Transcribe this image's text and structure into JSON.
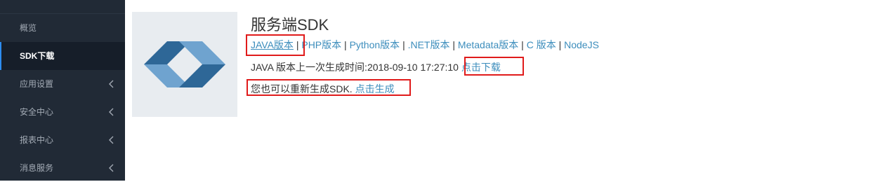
{
  "sidebar": {
    "top_fragment": "",
    "items": [
      {
        "label": "概览",
        "active": false,
        "has_chevron": false
      },
      {
        "label": "SDK下载",
        "active": true,
        "has_chevron": false
      },
      {
        "label": "应用设置",
        "active": false,
        "has_chevron": true
      },
      {
        "label": "安全中心",
        "active": false,
        "has_chevron": true
      },
      {
        "label": "报表中心",
        "active": false,
        "has_chevron": true
      },
      {
        "label": "消息服务",
        "active": false,
        "has_chevron": true
      }
    ]
  },
  "main": {
    "title": "服务端SDK",
    "sdk_links": [
      {
        "label": "JAVA版本"
      },
      {
        "label": "PHP版本"
      },
      {
        "label": "Python版本"
      },
      {
        "label": ".NET版本"
      },
      {
        "label": "Metadata版本"
      },
      {
        "label": "C 版本"
      },
      {
        "label": "NodeJS"
      }
    ],
    "separator": "|",
    "last_generated_text": "JAVA 版本上一次生成时间:2018-09-10 17:27:10",
    "download_link": "点击下载",
    "regenerate_text": "您也可以重新生成SDK.",
    "generate_link": "点击生成"
  },
  "colors": {
    "sidebar_bg": "#212a36",
    "sidebar_active_bg": "#161e29",
    "link": "#3c8dbc",
    "annotation_red": "#e01b1b",
    "logo_dark": "#2e6797",
    "logo_light": "#6fa3cf"
  }
}
